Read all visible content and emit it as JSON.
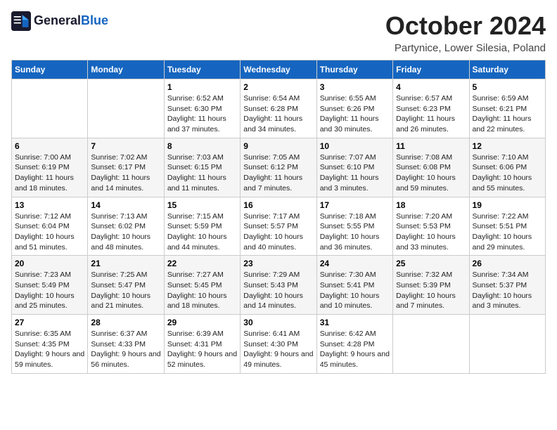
{
  "header": {
    "logo_general": "General",
    "logo_blue": "Blue",
    "month": "October 2024",
    "location": "Partynice, Lower Silesia, Poland"
  },
  "days_of_week": [
    "Sunday",
    "Monday",
    "Tuesday",
    "Wednesday",
    "Thursday",
    "Friday",
    "Saturday"
  ],
  "weeks": [
    [
      {
        "day": "",
        "info": ""
      },
      {
        "day": "",
        "info": ""
      },
      {
        "day": "1",
        "info": "Sunrise: 6:52 AM\nSunset: 6:30 PM\nDaylight: 11 hours and 37 minutes."
      },
      {
        "day": "2",
        "info": "Sunrise: 6:54 AM\nSunset: 6:28 PM\nDaylight: 11 hours and 34 minutes."
      },
      {
        "day": "3",
        "info": "Sunrise: 6:55 AM\nSunset: 6:26 PM\nDaylight: 11 hours and 30 minutes."
      },
      {
        "day": "4",
        "info": "Sunrise: 6:57 AM\nSunset: 6:23 PM\nDaylight: 11 hours and 26 minutes."
      },
      {
        "day": "5",
        "info": "Sunrise: 6:59 AM\nSunset: 6:21 PM\nDaylight: 11 hours and 22 minutes."
      }
    ],
    [
      {
        "day": "6",
        "info": "Sunrise: 7:00 AM\nSunset: 6:19 PM\nDaylight: 11 hours and 18 minutes."
      },
      {
        "day": "7",
        "info": "Sunrise: 7:02 AM\nSunset: 6:17 PM\nDaylight: 11 hours and 14 minutes."
      },
      {
        "day": "8",
        "info": "Sunrise: 7:03 AM\nSunset: 6:15 PM\nDaylight: 11 hours and 11 minutes."
      },
      {
        "day": "9",
        "info": "Sunrise: 7:05 AM\nSunset: 6:12 PM\nDaylight: 11 hours and 7 minutes."
      },
      {
        "day": "10",
        "info": "Sunrise: 7:07 AM\nSunset: 6:10 PM\nDaylight: 11 hours and 3 minutes."
      },
      {
        "day": "11",
        "info": "Sunrise: 7:08 AM\nSunset: 6:08 PM\nDaylight: 10 hours and 59 minutes."
      },
      {
        "day": "12",
        "info": "Sunrise: 7:10 AM\nSunset: 6:06 PM\nDaylight: 10 hours and 55 minutes."
      }
    ],
    [
      {
        "day": "13",
        "info": "Sunrise: 7:12 AM\nSunset: 6:04 PM\nDaylight: 10 hours and 51 minutes."
      },
      {
        "day": "14",
        "info": "Sunrise: 7:13 AM\nSunset: 6:02 PM\nDaylight: 10 hours and 48 minutes."
      },
      {
        "day": "15",
        "info": "Sunrise: 7:15 AM\nSunset: 5:59 PM\nDaylight: 10 hours and 44 minutes."
      },
      {
        "day": "16",
        "info": "Sunrise: 7:17 AM\nSunset: 5:57 PM\nDaylight: 10 hours and 40 minutes."
      },
      {
        "day": "17",
        "info": "Sunrise: 7:18 AM\nSunset: 5:55 PM\nDaylight: 10 hours and 36 minutes."
      },
      {
        "day": "18",
        "info": "Sunrise: 7:20 AM\nSunset: 5:53 PM\nDaylight: 10 hours and 33 minutes."
      },
      {
        "day": "19",
        "info": "Sunrise: 7:22 AM\nSunset: 5:51 PM\nDaylight: 10 hours and 29 minutes."
      }
    ],
    [
      {
        "day": "20",
        "info": "Sunrise: 7:23 AM\nSunset: 5:49 PM\nDaylight: 10 hours and 25 minutes."
      },
      {
        "day": "21",
        "info": "Sunrise: 7:25 AM\nSunset: 5:47 PM\nDaylight: 10 hours and 21 minutes."
      },
      {
        "day": "22",
        "info": "Sunrise: 7:27 AM\nSunset: 5:45 PM\nDaylight: 10 hours and 18 minutes."
      },
      {
        "day": "23",
        "info": "Sunrise: 7:29 AM\nSunset: 5:43 PM\nDaylight: 10 hours and 14 minutes."
      },
      {
        "day": "24",
        "info": "Sunrise: 7:30 AM\nSunset: 5:41 PM\nDaylight: 10 hours and 10 minutes."
      },
      {
        "day": "25",
        "info": "Sunrise: 7:32 AM\nSunset: 5:39 PM\nDaylight: 10 hours and 7 minutes."
      },
      {
        "day": "26",
        "info": "Sunrise: 7:34 AM\nSunset: 5:37 PM\nDaylight: 10 hours and 3 minutes."
      }
    ],
    [
      {
        "day": "27",
        "info": "Sunrise: 6:35 AM\nSunset: 4:35 PM\nDaylight: 9 hours and 59 minutes."
      },
      {
        "day": "28",
        "info": "Sunrise: 6:37 AM\nSunset: 4:33 PM\nDaylight: 9 hours and 56 minutes."
      },
      {
        "day": "29",
        "info": "Sunrise: 6:39 AM\nSunset: 4:31 PM\nDaylight: 9 hours and 52 minutes."
      },
      {
        "day": "30",
        "info": "Sunrise: 6:41 AM\nSunset: 4:30 PM\nDaylight: 9 hours and 49 minutes."
      },
      {
        "day": "31",
        "info": "Sunrise: 6:42 AM\nSunset: 4:28 PM\nDaylight: 9 hours and 45 minutes."
      },
      {
        "day": "",
        "info": ""
      },
      {
        "day": "",
        "info": ""
      }
    ]
  ]
}
